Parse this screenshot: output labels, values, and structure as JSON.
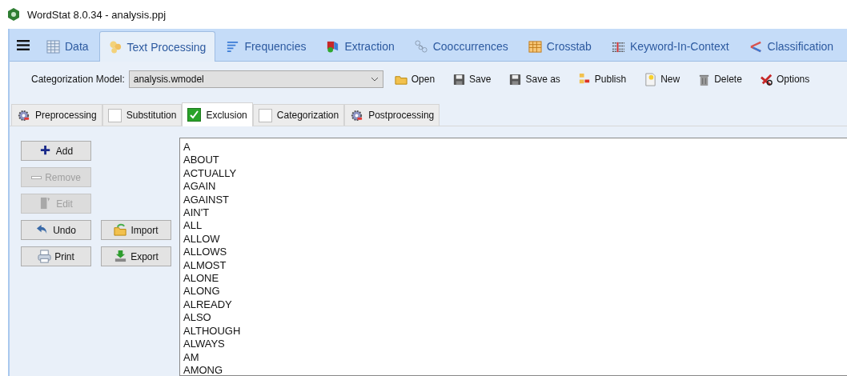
{
  "window": {
    "title": "WordStat 8.0.34 - analysis.ppj"
  },
  "main_tabs": [
    {
      "label": "Data",
      "kind": "grid",
      "selected": false
    },
    {
      "label": "Text Processing",
      "kind": "gears",
      "selected": true
    },
    {
      "label": "Frequencies",
      "kind": "lines",
      "selected": false
    },
    {
      "label": "Extraction",
      "kind": "cube",
      "selected": false
    },
    {
      "label": "Cooccurrences",
      "kind": "links",
      "selected": false
    },
    {
      "label": "Crosstab",
      "kind": "table",
      "selected": false
    },
    {
      "label": "Keyword-In-Context",
      "kind": "kwic",
      "selected": false
    },
    {
      "label": "Classification",
      "kind": "arrows",
      "selected": false
    }
  ],
  "toolbar": {
    "model_label": "Categorization Model:",
    "model_value": "analysis.wmodel",
    "buttons": [
      {
        "label": "Open",
        "kind": "folder"
      },
      {
        "label": "Save",
        "kind": "disk"
      },
      {
        "label": "Save as",
        "kind": "disk"
      },
      {
        "label": "Publish",
        "kind": "publish"
      },
      {
        "label": "New",
        "kind": "new"
      },
      {
        "label": "Delete",
        "kind": "trash"
      },
      {
        "label": "Options",
        "kind": "options"
      }
    ]
  },
  "sub_tabs": [
    {
      "label": "Preprocessing",
      "kind": "icon",
      "selected": false
    },
    {
      "label": "Substitution",
      "kind": "checkbox",
      "checked": false,
      "selected": false
    },
    {
      "label": "Exclusion",
      "kind": "checkbox",
      "checked": true,
      "selected": true
    },
    {
      "label": "Categorization",
      "kind": "checkbox",
      "checked": false,
      "selected": false
    },
    {
      "label": "Postprocessing",
      "kind": "icon",
      "selected": false
    }
  ],
  "button_rows": [
    [
      {
        "label": "Add",
        "kind": "plus",
        "disabled": false
      }
    ],
    [
      {
        "label": "Remove",
        "kind": "minus",
        "disabled": true
      }
    ],
    [
      {
        "label": "Edit",
        "kind": "edit",
        "disabled": true
      }
    ],
    [
      {
        "label": "Undo",
        "kind": "undo",
        "disabled": false
      },
      {
        "label": "Import",
        "kind": "import",
        "disabled": false
      }
    ],
    [
      {
        "label": "Print",
        "kind": "print",
        "disabled": false
      },
      {
        "label": "Export",
        "kind": "export",
        "disabled": false
      }
    ]
  ],
  "word_list": [
    "A",
    "ABOUT",
    "ACTUALLY",
    "AGAIN",
    "AGAINST",
    "AIN'T",
    "ALL",
    "ALLOW",
    "ALLOWS",
    "ALMOST",
    "ALONE",
    "ALONG",
    "ALREADY",
    "ALSO",
    "ALTHOUGH",
    "ALWAYS",
    "AM",
    "AMONG"
  ]
}
